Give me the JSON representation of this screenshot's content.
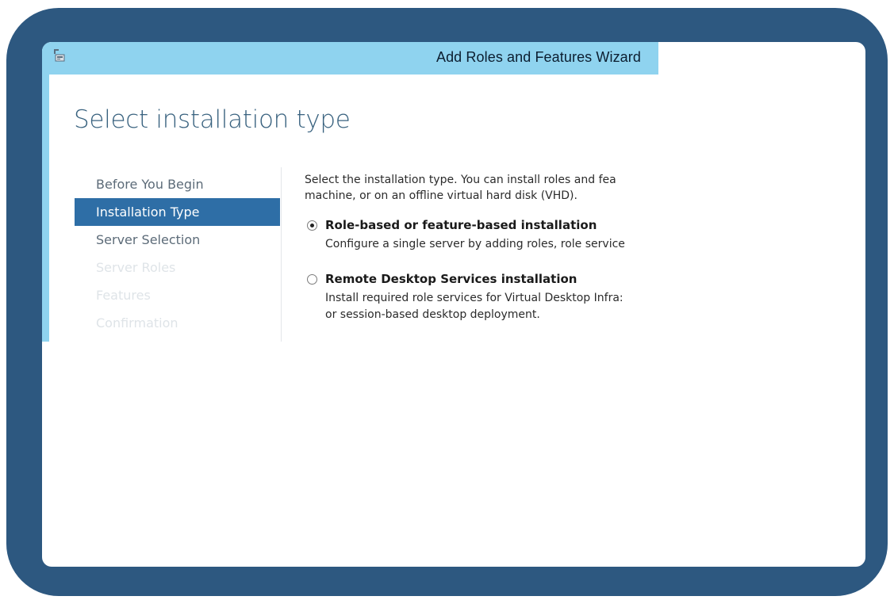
{
  "window": {
    "title": "Add Roles and Features Wizard",
    "icon": "server-manager-icon"
  },
  "page": {
    "title": "Select installation type"
  },
  "nav": {
    "items": [
      {
        "label": "Before You Begin",
        "state": "normal"
      },
      {
        "label": "Installation Type",
        "state": "active"
      },
      {
        "label": "Server Selection",
        "state": "normal"
      },
      {
        "label": "Server Roles",
        "state": "disabled"
      },
      {
        "label": "Features",
        "state": "disabled"
      },
      {
        "label": "Confirmation",
        "state": "disabled"
      }
    ]
  },
  "content": {
    "description_line1": "Select the installation type. You can install roles and fea",
    "description_line2": "machine, or on an offline virtual hard disk (VHD).",
    "options": [
      {
        "label": "Role-based or feature-based installation",
        "checked": true,
        "description_lines": [
          "Configure a single server by adding roles, role service"
        ]
      },
      {
        "label": "Remote Desktop Services installation",
        "checked": false,
        "description_lines": [
          "Install required role services for Virtual Desktop Infra:",
          "or session-based desktop deployment."
        ]
      }
    ]
  },
  "colors": {
    "frame": "#2d5880",
    "titlebar": "#8fd3ef",
    "nav_active": "#2e6ea6",
    "page_title": "#39627f"
  }
}
